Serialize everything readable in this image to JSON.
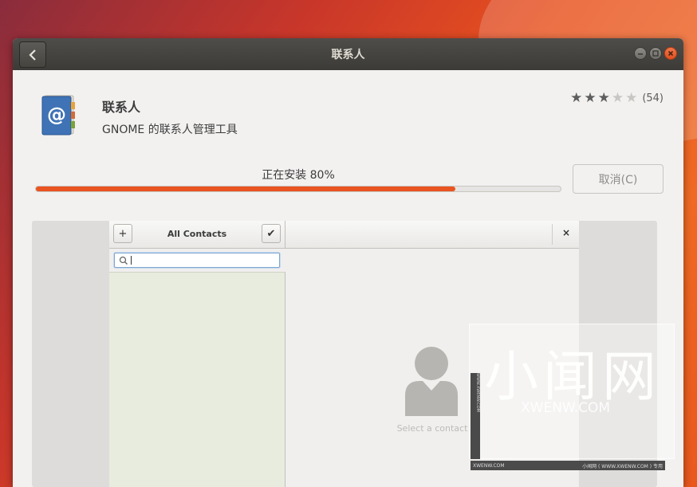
{
  "window": {
    "title": "联系人"
  },
  "app": {
    "name": "联系人",
    "description": "GNOME 的联系人管理工具",
    "rating": {
      "stars_filled": 3,
      "stars_total": 5,
      "review_count": "(54)"
    }
  },
  "install": {
    "status_label": "正在安装 80%",
    "progress": 0.8,
    "cancel_label": "取消(C)"
  },
  "screenshot": {
    "header_title": "All Contacts",
    "add_button": "+",
    "select_button": "✔",
    "close_button": "×",
    "empty_text": "Select a contact"
  },
  "watermark": {
    "big": "小闻网",
    "small": "XWENW.COM",
    "strip": "WWW.XWENW.COM",
    "footer_left": "XWENW.COM",
    "footer_right": "小闻网 ( WWW.XWENW.COM ) 专用"
  },
  "colors": {
    "accent": "#e95420",
    "titlebar": "#3c3b37"
  },
  "icons": [
    "back-arrow-icon",
    "minimize-icon",
    "maximize-icon",
    "close-icon",
    "address-book-icon",
    "star-icon",
    "search-icon",
    "person-avatar-icon"
  ]
}
